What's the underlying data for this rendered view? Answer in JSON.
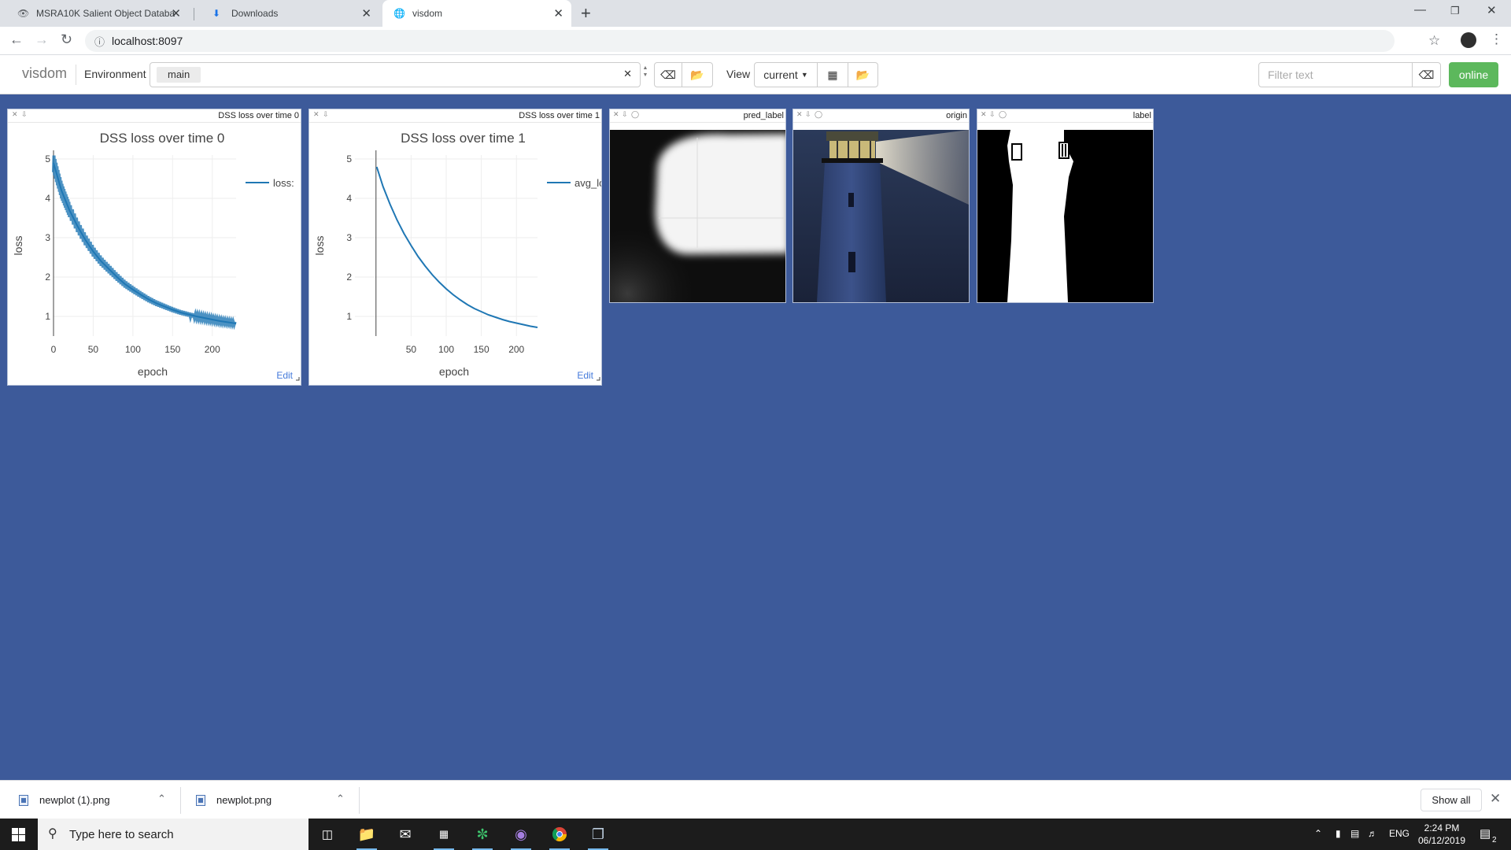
{
  "browser": {
    "tabs": [
      {
        "title": "MSRA10K Salient Object Databa",
        "icon": "eye-icon"
      },
      {
        "title": "Downloads",
        "icon": "download-icon"
      },
      {
        "title": "visdom",
        "icon": "globe-icon"
      }
    ],
    "active_tab": 2,
    "url": "localhost:8097"
  },
  "visdom": {
    "brand": "visdom",
    "environment_label": "Environment",
    "environment_selected": "main",
    "view_label": "View",
    "view_selected": "current",
    "filter_placeholder": "Filter text",
    "status": "online",
    "status_color": "#5cb85c"
  },
  "panes": [
    {
      "title": "DSS loss over time 0",
      "type": "plot"
    },
    {
      "title": "DSS loss over time 1",
      "type": "plot"
    },
    {
      "title": "pred_label",
      "type": "image"
    },
    {
      "title": "origin",
      "type": "image"
    },
    {
      "title": "label",
      "type": "image"
    }
  ],
  "chart_data": [
    {
      "type": "line",
      "title": "DSS loss over time 0",
      "xlabel": "epoch",
      "ylabel": "loss",
      "series": [
        {
          "name": "loss:",
          "color": "#1f77b4",
          "noisy": true,
          "x": [
            0,
            5,
            10,
            15,
            20,
            30,
            40,
            50,
            60,
            70,
            80,
            90,
            100,
            110,
            120,
            130,
            140,
            150,
            160,
            170,
            180,
            190,
            200,
            210,
            220,
            230
          ],
          "y": [
            4.9,
            4.55,
            4.2,
            3.95,
            3.7,
            3.3,
            2.95,
            2.65,
            2.4,
            2.2,
            2.0,
            1.82,
            1.68,
            1.55,
            1.43,
            1.33,
            1.25,
            1.17,
            1.1,
            1.05,
            1.0,
            0.96,
            0.92,
            0.88,
            0.85,
            0.82
          ]
        }
      ],
      "xticks": [
        0,
        50,
        100,
        150,
        200
      ],
      "yticks": [
        1,
        2,
        3,
        4,
        5
      ],
      "xlim": [
        0,
        230
      ],
      "ylim": [
        0.5,
        5.1
      ],
      "grid": true,
      "legend": "top-right",
      "edit_label": "Edit"
    },
    {
      "type": "line",
      "title": "DSS loss over time 1",
      "xlabel": "epoch",
      "ylabel": "loss",
      "series": [
        {
          "name": "avg_loss",
          "color": "#1f77b4",
          "noisy": false,
          "x": [
            1,
            10,
            20,
            30,
            40,
            50,
            60,
            70,
            80,
            90,
            100,
            110,
            120,
            130,
            140,
            150,
            160,
            170,
            180,
            190,
            200,
            210,
            220,
            230
          ],
          "y": [
            4.8,
            4.3,
            3.85,
            3.45,
            3.1,
            2.8,
            2.52,
            2.28,
            2.06,
            1.87,
            1.7,
            1.55,
            1.42,
            1.3,
            1.2,
            1.12,
            1.04,
            0.98,
            0.92,
            0.87,
            0.83,
            0.79,
            0.75,
            0.72
          ]
        }
      ],
      "xticks": [
        50,
        100,
        150,
        200
      ],
      "yticks": [
        1,
        2,
        3,
        4,
        5
      ],
      "xlim": [
        -30,
        230
      ],
      "ylim": [
        0.5,
        5.1
      ],
      "grid": true,
      "legend": "top-right",
      "edit_label": "Edit"
    }
  ],
  "downloads": {
    "items": [
      {
        "name": "newplot (1).png"
      },
      {
        "name": "newplot.png"
      }
    ],
    "show_all": "Show all"
  },
  "taskbar": {
    "search_placeholder": "Type here to search",
    "language": "ENG",
    "time": "2:24 PM",
    "date": "06/12/2019",
    "notifications": "2"
  }
}
